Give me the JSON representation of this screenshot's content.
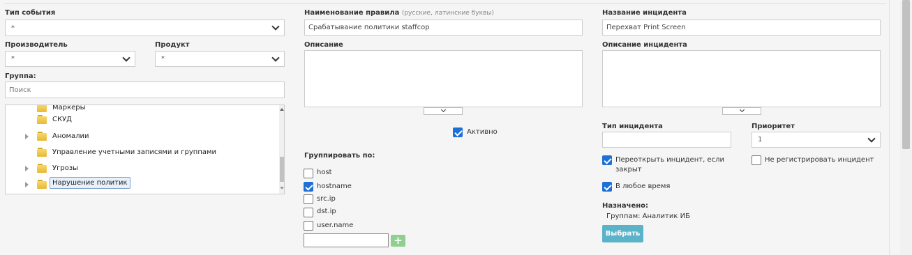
{
  "left": {
    "event_type": {
      "label": "Тип события",
      "value": "*"
    },
    "vendor": {
      "label": "Производитель",
      "value": "*"
    },
    "product": {
      "label": "Продукт",
      "value": "*"
    },
    "group": {
      "label": "Группа:",
      "search_placeholder": "Поиск"
    },
    "tree": {
      "items": [
        {
          "label": "Маркеры",
          "expandable": false
        },
        {
          "label": "СКУД",
          "expandable": false
        },
        {
          "label": "Аномалии",
          "expandable": true
        },
        {
          "label": "Управление учетными записями и группами",
          "expandable": false
        },
        {
          "label": "Угрозы",
          "expandable": true
        },
        {
          "label": "Нарушение политик",
          "expandable": true,
          "selected": true
        }
      ]
    }
  },
  "middle": {
    "rule_name": {
      "label": "Наименование правила",
      "hint": "(русские, латинские буквы)",
      "value": "Срабатывание политики staffcop"
    },
    "description": {
      "label": "Описание",
      "value": ""
    },
    "active": {
      "label": "Активно",
      "checked": true
    },
    "group_by": {
      "label": "Группировать по:",
      "fields": [
        {
          "label": "host",
          "checked": false
        },
        {
          "label": "hostname",
          "checked": true
        },
        {
          "label": "src.ip",
          "checked": false
        },
        {
          "label": "dst.ip",
          "checked": false
        },
        {
          "label": "user.name",
          "checked": false
        }
      ],
      "new_field_value": ""
    }
  },
  "right": {
    "incident_name": {
      "label": "Название инцидента",
      "value": "Перехват Print Screen"
    },
    "incident_description": {
      "label": "Описание инцидента",
      "value": ""
    },
    "incident_type": {
      "label": "Тип инцидента",
      "value": ""
    },
    "priority": {
      "label": "Приоритет",
      "value": "1"
    },
    "reopen": {
      "label_line1": "Переоткрыть инцидент, если",
      "label_line2": "закрыт",
      "checked": true
    },
    "no_register": {
      "label": "Не регистрировать инцидент",
      "checked": false
    },
    "any_time": {
      "label": "В любое время",
      "checked": true
    },
    "assigned": {
      "label": "Назначено:",
      "value": "Группам: Аналитик ИБ"
    },
    "select_button": "Выбрать"
  },
  "colors": {
    "checkbox": "#1e6fd6",
    "select_button": "#5bb3c9",
    "add_button": "#8fcf8f"
  }
}
